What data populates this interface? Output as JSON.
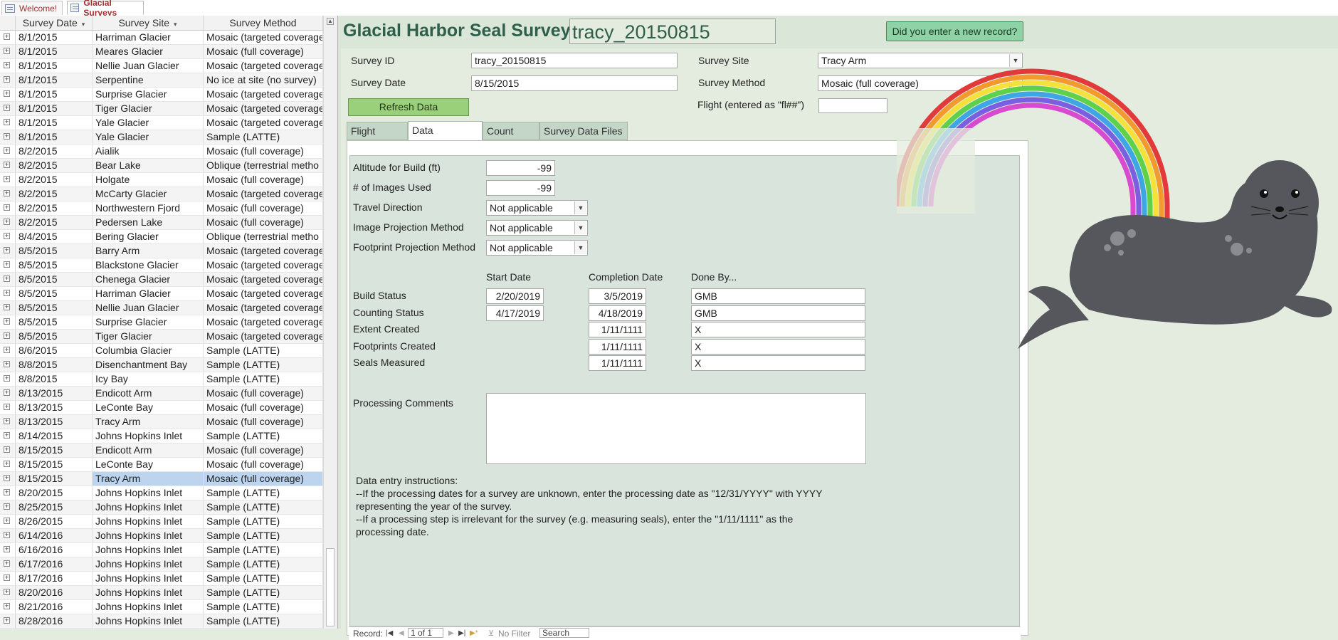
{
  "doc_tabs": [
    {
      "label": "Welcome!"
    },
    {
      "label": "Glacial Surveys"
    }
  ],
  "datasheet": {
    "columns": [
      "Survey Date",
      "Survey Site",
      "Survey Method"
    ],
    "rows": [
      {
        "date": "8/1/2015",
        "site": "Harriman Glacier",
        "method": "Mosaic (targeted coverage"
      },
      {
        "date": "8/1/2015",
        "site": "Meares Glacier",
        "method": "Mosaic (full coverage)"
      },
      {
        "date": "8/1/2015",
        "site": "Nellie Juan Glacier",
        "method": "Mosaic (targeted coverage"
      },
      {
        "date": "8/1/2015",
        "site": "Serpentine",
        "method": "No ice at site (no survey)"
      },
      {
        "date": "8/1/2015",
        "site": "Surprise Glacier",
        "method": "Mosaic (targeted coverage"
      },
      {
        "date": "8/1/2015",
        "site": "Tiger Glacier",
        "method": "Mosaic (targeted coverage"
      },
      {
        "date": "8/1/2015",
        "site": "Yale Glacier",
        "method": "Mosaic (targeted coverage"
      },
      {
        "date": "8/1/2015",
        "site": "Yale Glacier",
        "method": "Sample (LATTE)"
      },
      {
        "date": "8/2/2015",
        "site": "Aialik",
        "method": "Mosaic (full coverage)"
      },
      {
        "date": "8/2/2015",
        "site": "Bear Lake",
        "method": "Oblique (terrestrial metho"
      },
      {
        "date": "8/2/2015",
        "site": "Holgate",
        "method": "Mosaic (full coverage)"
      },
      {
        "date": "8/2/2015",
        "site": "McCarty Glacier",
        "method": "Mosaic (targeted coverage"
      },
      {
        "date": "8/2/2015",
        "site": "Northwestern Fjord",
        "method": "Mosaic (full coverage)"
      },
      {
        "date": "8/2/2015",
        "site": "Pedersen Lake",
        "method": "Mosaic (full coverage)"
      },
      {
        "date": "8/4/2015",
        "site": "Bering Glacier",
        "method": "Oblique (terrestrial metho"
      },
      {
        "date": "8/5/2015",
        "site": "Barry Arm",
        "method": "Mosaic (targeted coverage"
      },
      {
        "date": "8/5/2015",
        "site": "Blackstone Glacier",
        "method": "Mosaic (targeted coverage"
      },
      {
        "date": "8/5/2015",
        "site": "Chenega Glacier",
        "method": "Mosaic (targeted coverage"
      },
      {
        "date": "8/5/2015",
        "site": "Harriman Glacier",
        "method": "Mosaic (targeted coverage"
      },
      {
        "date": "8/5/2015",
        "site": "Nellie Juan Glacier",
        "method": "Mosaic (targeted coverage"
      },
      {
        "date": "8/5/2015",
        "site": "Surprise Glacier",
        "method": "Mosaic (targeted coverage"
      },
      {
        "date": "8/5/2015",
        "site": "Tiger Glacier",
        "method": "Mosaic (targeted coverage"
      },
      {
        "date": "8/6/2015",
        "site": "Columbia Glacier",
        "method": "Sample (LATTE)"
      },
      {
        "date": "8/8/2015",
        "site": "Disenchantment Bay",
        "method": "Sample (LATTE)"
      },
      {
        "date": "8/8/2015",
        "site": "Icy Bay",
        "method": "Sample (LATTE)"
      },
      {
        "date": "8/13/2015",
        "site": "Endicott Arm",
        "method": "Mosaic (full coverage)"
      },
      {
        "date": "8/13/2015",
        "site": "LeConte Bay",
        "method": "Mosaic (full coverage)"
      },
      {
        "date": "8/13/2015",
        "site": "Tracy Arm",
        "method": "Mosaic (full coverage)"
      },
      {
        "date": "8/14/2015",
        "site": "Johns Hopkins Inlet",
        "method": "Sample (LATTE)"
      },
      {
        "date": "8/15/2015",
        "site": "Endicott Arm",
        "method": "Mosaic (full coverage)"
      },
      {
        "date": "8/15/2015",
        "site": "LeConte Bay",
        "method": "Mosaic (full coverage)"
      },
      {
        "date": "8/15/2015",
        "site": "Tracy Arm",
        "method": "Mosaic (full coverage)",
        "current": true
      },
      {
        "date": "8/20/2015",
        "site": "Johns Hopkins Inlet",
        "method": "Sample (LATTE)"
      },
      {
        "date": "8/25/2015",
        "site": "Johns Hopkins Inlet",
        "method": "Sample (LATTE)"
      },
      {
        "date": "8/26/2015",
        "site": "Johns Hopkins Inlet",
        "method": "Sample (LATTE)"
      },
      {
        "date": "6/14/2016",
        "site": "Johns Hopkins Inlet",
        "method": "Sample (LATTE)"
      },
      {
        "date": "6/16/2016",
        "site": "Johns Hopkins Inlet",
        "method": "Sample (LATTE)"
      },
      {
        "date": "6/17/2016",
        "site": "Johns Hopkins Inlet",
        "method": "Sample (LATTE)"
      },
      {
        "date": "8/17/2016",
        "site": "Johns Hopkins Inlet",
        "method": "Sample (LATTE)"
      },
      {
        "date": "8/20/2016",
        "site": "Johns Hopkins Inlet",
        "method": "Sample (LATTE)"
      },
      {
        "date": "8/21/2016",
        "site": "Johns Hopkins Inlet",
        "method": "Sample (LATTE)"
      },
      {
        "date": "8/28/2016",
        "site": "Johns Hopkins Inlet",
        "method": "Sample (LATTE)"
      }
    ]
  },
  "form": {
    "title": "Glacial Harbor Seal Survey:",
    "title_value": "tracy_20150815",
    "new_record_button": "Did you enter a new record?",
    "survey_id_label": "Survey ID",
    "survey_id": "tracy_20150815",
    "survey_date_label": "Survey Date",
    "survey_date": "8/15/2015",
    "survey_site_label": "Survey Site",
    "survey_site": "Tracy Arm",
    "survey_method_label": "Survey Method",
    "survey_method": "Mosaic (full coverage)",
    "flight_label": "Flight (entered as \"fl##\")",
    "flight_value": "",
    "refresh_button": "Refresh Data",
    "tabs": [
      "Flight Details",
      "Data Processing",
      "Count Data",
      "Survey Data Files"
    ],
    "active_tab": "Data Processing"
  },
  "processing": {
    "altitude_label": "Altitude for Build (ft)",
    "altitude": "-99",
    "images_label": "# of Images Used",
    "images": "-99",
    "travel_label": "Travel Direction",
    "travel": "Not applicable",
    "image_proj_label": "Image Projection Method",
    "image_proj": "Not applicable",
    "footprint_proj_label": "Footprint Projection Method",
    "footprint_proj": "Not applicable",
    "col_start": "Start Date",
    "col_completion": "Completion Date",
    "col_done_by": "Done By...",
    "steps": [
      {
        "label": "Build Status",
        "start": "2/20/2019",
        "completion": "3/5/2019",
        "done_by": "GMB"
      },
      {
        "label": "Counting Status",
        "start": "4/17/2019",
        "completion": "4/18/2019",
        "done_by": "GMB"
      },
      {
        "label": "Extent Created",
        "start": "",
        "completion": "1/11/1111",
        "done_by": "X"
      },
      {
        "label": "Footprints Created",
        "start": "",
        "completion": "1/11/1111",
        "done_by": "X"
      },
      {
        "label": "Seals Measured",
        "start": "",
        "completion": "1/11/1111",
        "done_by": "X"
      }
    ],
    "comments_label": "Processing Comments",
    "comments": "",
    "instructions": [
      "Data entry instructions:",
      "--If the processing dates for a survey are unknown, enter the processing date as \"12/31/YYYY\" with YYYY",
      "representing the year of the survey.",
      "--If a processing step is irrelevant for the survey (e.g. measuring seals), enter the \"1/11/1111\" as the",
      "processing date."
    ]
  },
  "record_nav": {
    "record_label": "Record:",
    "position": "1 of 1",
    "filter_label": "No Filter",
    "search_label": "Search"
  },
  "colors": {
    "current_row": "#bcd4ee",
    "title_green": "#2f5f4a",
    "refresh_green": "#9bd07a",
    "new_record_green": "#8fd2a5"
  }
}
